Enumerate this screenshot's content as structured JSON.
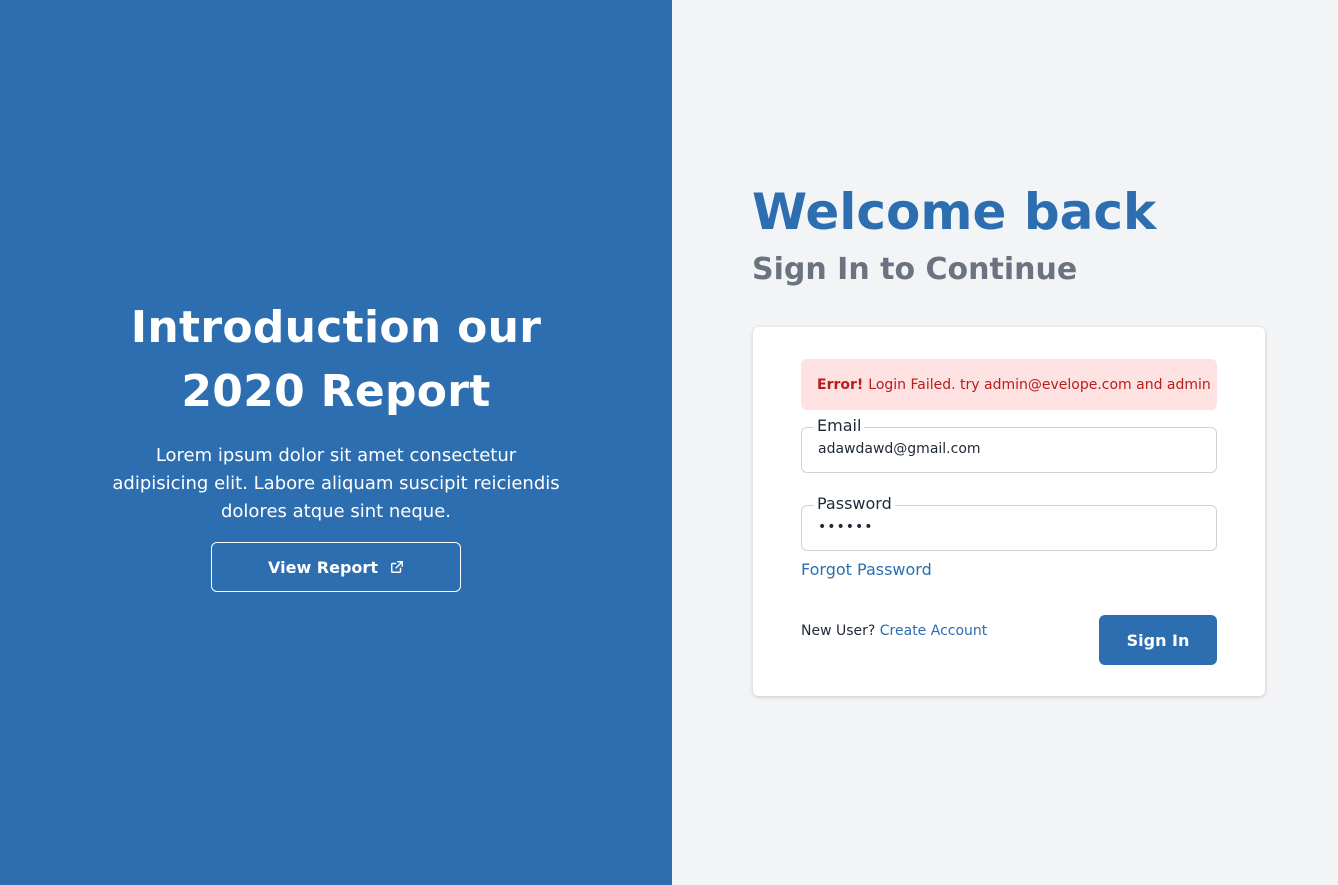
{
  "left_panel": {
    "title_line1": "Introduction our",
    "title_line2": "2020 Report",
    "description": "Lorem ipsum dolor sit amet consectetur adipisicing elit. Labore aliquam suscipit reiciendis dolores atque sint neque.",
    "view_report_label": "View Report",
    "view_report_icon": "external-link-icon",
    "background_color": "#2c6eb0"
  },
  "right_panel": {
    "welcome": "Welcome back",
    "subtitle": "Sign In to Continue",
    "background_color": "#f3f4f6"
  },
  "login_form": {
    "error": {
      "prefix": "Error!",
      "message": "Login Failed. try admin@evelope.com and admin",
      "background_color": "#fee2e2",
      "text_color": "#b91c1c"
    },
    "email": {
      "label": "Email",
      "value": "adawdawd@gmail.com"
    },
    "password": {
      "label": "Password",
      "value": "••••••"
    },
    "forgot_password_label": "Forgot Password",
    "new_user_text": "New User?",
    "create_account_label": "Create Account",
    "sign_in_label": "Sign In",
    "accent_color": "#2c6eb0"
  }
}
